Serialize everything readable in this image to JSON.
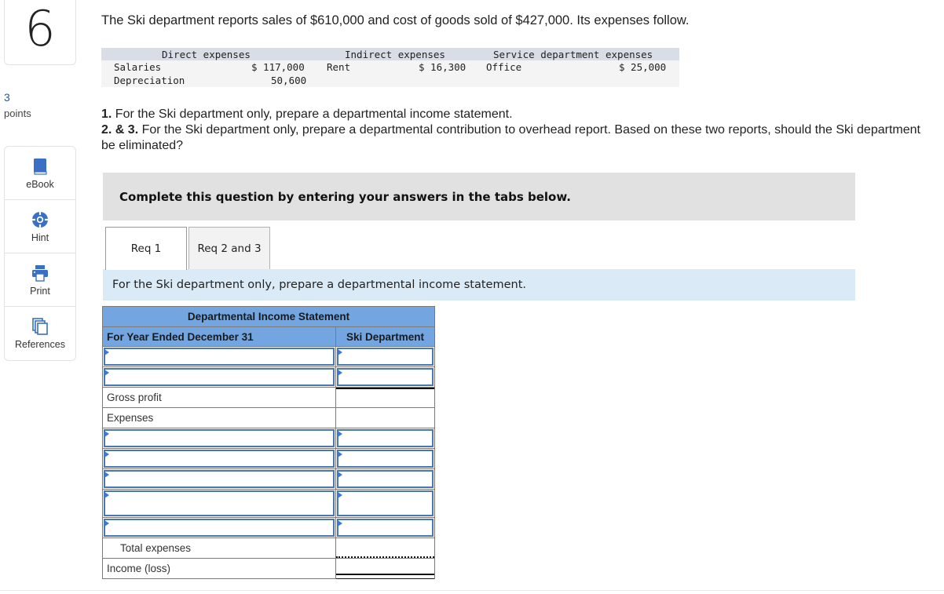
{
  "question": {
    "number": "6",
    "points_value": "3",
    "points_label": "points"
  },
  "tools": [
    {
      "label": "eBook",
      "icon": "book-icon"
    },
    {
      "label": "Hint",
      "icon": "lifebuoy-icon"
    },
    {
      "label": "Print",
      "icon": "printer-icon"
    },
    {
      "label": "References",
      "icon": "documents-icon"
    }
  ],
  "intro": "The Ski department reports sales of $610,000 and cost of goods sold of $427,000. Its expenses follow.",
  "expenses": {
    "headers": {
      "direct": "Direct expenses",
      "indirect": "Indirect expenses",
      "service": "Service department expenses"
    },
    "direct": [
      {
        "label": "Salaries",
        "value": "$ 117,000"
      },
      {
        "label": "Depreciation",
        "value": "50,600"
      }
    ],
    "indirect": [
      {
        "label": "Rent",
        "value": "$ 16,300"
      }
    ],
    "service": [
      {
        "label": "Office",
        "value": "$ 25,000"
      }
    ]
  },
  "requirements": {
    "r1_num": "1.",
    "r1_text": " For the Ski department only, prepare a departmental income statement.",
    "r23_num": "2. & 3.",
    "r23_text": " For the Ski department only, prepare a departmental contribution to overhead report. Based on these two reports, should the Ski department be eliminated?"
  },
  "banner": "Complete this question by entering your answers in the tabs below.",
  "tabs": [
    {
      "label": "Req 1",
      "active": true
    },
    {
      "label": "Req 2 and 3",
      "active": false
    }
  ],
  "instruction": "For the Ski department only, prepare a departmental income statement.",
  "statement": {
    "title": "Departmental Income Statement",
    "period_header": "For Year Ended December 31",
    "column_header": "Ski Department",
    "rows": {
      "gross_profit": "Gross profit",
      "expenses": "Expenses",
      "total_expenses": "Total expenses",
      "income_loss": "Income (loss)"
    },
    "input_values": {
      "line1_label": "",
      "line1_value": "",
      "line2_label": "",
      "line2_value": "",
      "exp1_label": "",
      "exp1_value": "",
      "exp2_label": "",
      "exp2_value": "",
      "exp3_label": "",
      "exp3_value": "",
      "exp4_label": "",
      "exp4_value": "",
      "exp5_label": "",
      "exp5_value": ""
    }
  }
}
